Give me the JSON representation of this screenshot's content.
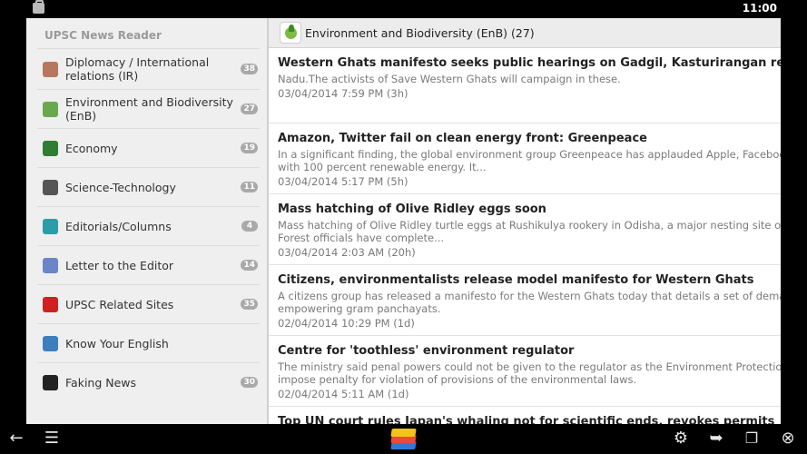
{
  "status": {
    "time": "11:00"
  },
  "sidebar": {
    "title": "UPSC News Reader",
    "items": [
      {
        "label": "Diplomacy / International relations (IR)",
        "count": "38",
        "icon": "globe-icon",
        "color": "#b7775e"
      },
      {
        "label": "Environment and Biodiversity (EnB)",
        "count": "27",
        "icon": "leaf-icon",
        "color": "#6aa84f"
      },
      {
        "label": "Economy",
        "count": "19",
        "icon": "economy-icon",
        "color": "#2e7d32"
      },
      {
        "label": "Science-Technology",
        "count": "11",
        "icon": "atom-icon",
        "color": "#555555"
      },
      {
        "label": "Editorials/Columns",
        "count": "4",
        "icon": "pen-icon",
        "color": "#2a9da8"
      },
      {
        "label": "Letter to the Editor",
        "count": "14",
        "icon": "letter-icon",
        "color": "#6a86c9"
      },
      {
        "label": "UPSC Related Sites",
        "count": "35",
        "icon": "upsc-icon",
        "color": "#cc2222"
      },
      {
        "label": "Know Your English",
        "count": "",
        "icon": "english-icon",
        "color": "#3d7ebf"
      },
      {
        "label": "Faking News",
        "count": "30",
        "icon": "fn-icon",
        "color": "#222222"
      }
    ]
  },
  "header": {
    "title": "Environment and Biodiversity (EnB) (27)"
  },
  "articles": [
    {
      "title": "Western Ghats manifesto seeks public hearings on Gadgil, Kasturirangan reports to avoid",
      "snippet": [
        "Nadu.The activists of Save Western Ghats will campaign in these."
      ],
      "date": "03/04/2014 7:59 PM (3h)"
    },
    {
      "title": "Amazon, Twitter fail on clean energy front: Greenpeace",
      "snippet": [
        "In a significant finding, the global environment group Greenpeace has applauded Apple, Facebook and Google",
        "with 100 percent renewable energy. It..."
      ],
      "date": "03/04/2014 5:17 PM (5h)"
    },
    {
      "title": "Mass hatching of Olive Ridley eggs soon",
      "snippet": [
        "Mass hatching of Olive Ridley turtle eggs at Rushikulya rookery in Odisha, a major nesting site of these endangered",
        "Forest officials have complete..."
      ],
      "date": "03/04/2014 2:03 AM (20h)"
    },
    {
      "title": "Citizens, environmentalists release model manifesto for Western Ghats",
      "snippet": [
        "A citizens group has released a manifesto for the Western Ghats today that details a set of demands to protect",
        "empowering gram panchayats."
      ],
      "date": "02/04/2014 10:29 PM (1d)"
    },
    {
      "title": "Centre for 'toothless' environment regulator",
      "snippet": [
        "The ministry said penal powers could not be given to the regulator as the Environment Protection Act (EPA)",
        "impose penalty for violation of provisions of the environmental laws."
      ],
      "date": "02/04/2014 5:11 AM (1d)"
    },
    {
      "title": "Top UN court rules Japan's whaling not for scientific ends, revokes permits",
      "snippet": [],
      "date": ""
    }
  ],
  "navbar": {
    "back": "back-icon",
    "menu": "menu-icon",
    "home": "bluestacks-icon",
    "settings": "settings-icon",
    "share": "share-icon",
    "window": "window-icon",
    "close": "close-icon"
  }
}
